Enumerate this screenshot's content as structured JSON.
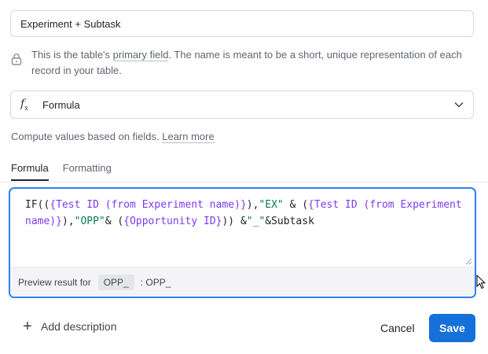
{
  "field_name": {
    "value": "Experiment + Subtask"
  },
  "primary_note": {
    "prefix": "This is the table's ",
    "link": "primary field",
    "suffix": ". The name is meant to be a short, unique representation of each record in your table."
  },
  "field_type": {
    "icon": "formula-fx-icon",
    "label": "Formula"
  },
  "compute_note": {
    "text": "Compute values based on fields. ",
    "link": "Learn more"
  },
  "tabs": [
    {
      "label": "Formula",
      "active": true
    },
    {
      "label": "Formatting",
      "active": false
    }
  ],
  "formula": {
    "tokens": [
      {
        "t": "IF((",
        "k": "fn"
      },
      {
        "t": "{Test ID (from Experiment name)}",
        "k": "fld"
      },
      {
        "t": "),",
        "k": "fn"
      },
      {
        "t": "\"EX\"",
        "k": "str"
      },
      {
        "t": " & (",
        "k": "fn"
      },
      {
        "t": "{Test ID (from Experiment name)}",
        "k": "fld"
      },
      {
        "t": "),",
        "k": "fn"
      },
      {
        "t": "\"OPP\"",
        "k": "str"
      },
      {
        "t": "& (",
        "k": "fn"
      },
      {
        "t": "{Opportunity ID}",
        "k": "fld"
      },
      {
        "t": ")) &",
        "k": "fn"
      },
      {
        "t": "\"_\"",
        "k": "str"
      },
      {
        "t": "&Subtask",
        "k": "fn"
      }
    ]
  },
  "preview": {
    "label": "Preview result for",
    "chip": "OPP_",
    "result": ": OPP_"
  },
  "footer": {
    "add_description": "Add description",
    "cancel": "Cancel",
    "save": "Save"
  },
  "colors": {
    "accent": "#2d7ff9",
    "save": "#1570d9",
    "field_token": "#7c3aed",
    "string_token": "#0b7a55"
  }
}
